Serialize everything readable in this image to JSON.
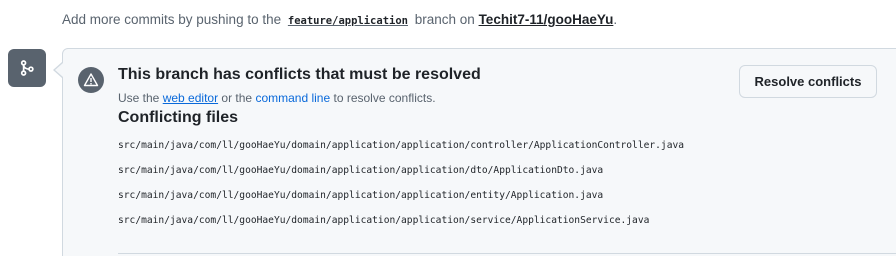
{
  "push_notice": {
    "prefix": "Add more commits by pushing to the",
    "branch": "feature/application",
    "middle": "branch on",
    "repo": "Techit7-11/gooHaeYu",
    "suffix": "."
  },
  "icons": {
    "badge": "git-branch-icon",
    "alert": "alert-icon"
  },
  "conflicts": {
    "title": "This branch has conflicts that must be resolved",
    "help_prefix": "Use the",
    "web_editor_link": "web editor",
    "help_middle": "or the",
    "command_line_link": "command line",
    "help_suffix": "to resolve conflicts.",
    "resolve_button": "Resolve conflicts",
    "files_heading": "Conflicting files",
    "files": [
      "src/main/java/com/ll/gooHaeYu/domain/application/application/controller/ApplicationController.java",
      "src/main/java/com/ll/gooHaeYu/domain/application/application/dto/ApplicationDto.java",
      "src/main/java/com/ll/gooHaeYu/domain/application/application/entity/Application.java",
      "src/main/java/com/ll/gooHaeYu/domain/application/application/service/ApplicationService.java"
    ]
  },
  "colors": {
    "link": "#0969da",
    "muted": "#59636e",
    "badge_bg": "#59636e",
    "panel_bg": "#f6f8fa",
    "border": "#d1d9e0"
  }
}
